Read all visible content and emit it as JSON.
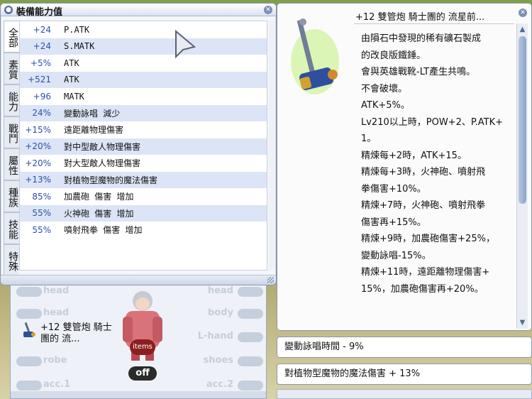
{
  "stats_window": {
    "title": "裝備能力值",
    "close_icon": "close-icon",
    "tabs": [
      {
        "label": "全部",
        "active": true
      },
      {
        "label": "素質",
        "active": false
      },
      {
        "label": "能力",
        "active": false
      },
      {
        "label": "戰鬥",
        "active": false
      },
      {
        "label": "屬性",
        "active": false
      },
      {
        "label": "種族",
        "active": false
      },
      {
        "label": "技能",
        "active": false
      },
      {
        "label": "特殊",
        "active": false
      }
    ],
    "rows": [
      {
        "value": "+24",
        "name": "P.ATK"
      },
      {
        "value": "+24",
        "name": "S.MATK"
      },
      {
        "value": "+5%",
        "name": "ATK"
      },
      {
        "value": "+521",
        "name": "ATK"
      },
      {
        "value": "+96",
        "name": "MATK"
      },
      {
        "value": "24%",
        "name": "變動詠唱 減少"
      },
      {
        "value": "+15%",
        "name": "遠距離物理傷害"
      },
      {
        "value": "+20%",
        "name": "對中型敵人物理傷害"
      },
      {
        "value": "+20%",
        "name": "對大型敵人物理傷害"
      },
      {
        "value": "+13%",
        "name": "對植物型魔物的魔法傷害"
      },
      {
        "value": "85%",
        "name": "加農砲 傷害 增加"
      },
      {
        "value": "55%",
        "name": "火神砲 傷害 增加"
      },
      {
        "value": "55%",
        "name": "噴射飛拳 傷害 增加"
      }
    ]
  },
  "item_window": {
    "name": "+12 雙管炮 騎士團的 流星前...",
    "description": [
      "由隕石中發現的稀有礦石製成",
      "的改良版鐵錘。",
      "會與英雄戰靴-LT產生共鳴。",
      "不會破壞。",
      "ATK+5%。",
      "Lv210以上時，POW+2、P.ATK+",
      "1。",
      "精煉每+2時，ATK+15。",
      "精煉每+3時，火神砲、噴射飛",
      "拳傷害+10%。",
      "精煉+7時，火神砲、噴射飛拳",
      "傷害再+15%。",
      "精煉+9時，加農砲傷害+25%，",
      "變動詠唱-15%。",
      "精煉+11時，遠距離物理傷害+",
      "15%，加農砲傷害再+20%。"
    ]
  },
  "tooltips": {
    "cast_time": "變動詠唱時間 - 9%",
    "plant_magic": "對植物型魔物的魔法傷害 + 13%"
  },
  "equip_window": {
    "slots_left": [
      "head",
      "head",
      "",
      "robe",
      "acc.1"
    ],
    "slots_right": [
      "head",
      "body",
      "L-hand",
      "shoes",
      "acc.2"
    ],
    "equipped_item": "+12 雙管炮 騎士團的 流...",
    "items_label": "items",
    "off_label": "off"
  }
}
